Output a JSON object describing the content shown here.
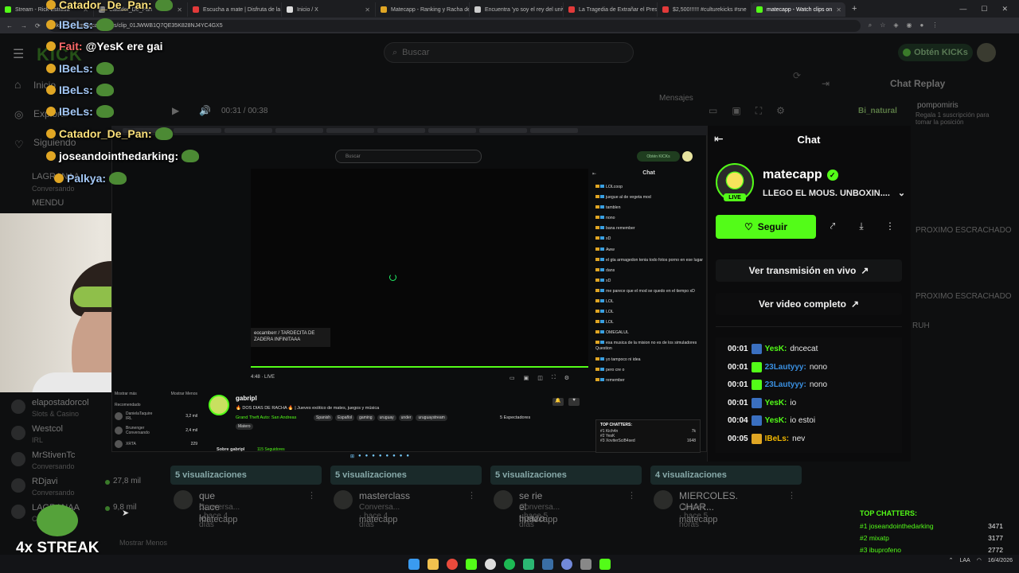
{
  "browser": {
    "tabs": [
      {
        "title": "Stream - Rick Estrada",
        "color": "#53fc18"
      },
      {
        "title": "Catador_De_Pan",
        "color": "#888888"
      },
      {
        "title": "Escucha a mate | Disfruta de la",
        "color": "#e23a3a"
      },
      {
        "title": "Inicio / X",
        "color": "#dddddd"
      },
      {
        "title": "Matecapp - Ranking y Racha de",
        "color": "#e0a624"
      },
      {
        "title": "Encuentra 'yo soy el rey del univ",
        "color": "#cccccc"
      },
      {
        "title": "La Tragedia de Extrañar el Pres",
        "color": "#e23a3a"
      },
      {
        "title": "$2,500!!!!!! #culturekicks #sne",
        "color": "#e23a3a"
      },
      {
        "title": "matecapp - Watch clips on",
        "color": "#53fc18"
      }
    ],
    "url": "kick.com/matecapp/clips/clip_01JWWB1Q7QE35K828NJ4YC4GX5",
    "new_tab": "+",
    "window_controls": [
      "—",
      "☐",
      "✕"
    ]
  },
  "kick_bg": {
    "logo": "KICK",
    "search_placeholder": "Buscar",
    "kicks_button": "Obtén KICKs",
    "sidebar": [
      {
        "label": "Inicio",
        "sub": ""
      },
      {
        "label": "Explorar",
        "sub": ""
      },
      {
        "label": "Siguiendo",
        "sub": ""
      },
      {
        "label": "LAGRANAA",
        "sub": "Conversando"
      },
      {
        "label": "MENDU",
        "sub": ""
      }
    ],
    "sidebar_lower": [
      {
        "name": "elapostadorcol",
        "sub": "Slots & Casino",
        "count": ""
      },
      {
        "name": "Westcol",
        "sub": "IRL",
        "count": ""
      },
      {
        "name": "MrStivenTc",
        "sub": "Conversando",
        "count": ""
      },
      {
        "name": "RDjavi",
        "sub": "Conversando",
        "count": "27,8 mil"
      },
      {
        "name": "LAGRANAA",
        "sub": "Conversando",
        "count": "9,8 mil"
      }
    ],
    "mostrar_menos": "Mostrar Menos",
    "player_time": "00:31 / 00:38",
    "mensajes": "Mensajes",
    "chat_replay_title": "Chat Replay",
    "replay_right": [
      {
        "user": "Bi_natural",
        "text": ""
      },
      {
        "user": "pompomiris",
        "text": "Regala 1 suscripción para tomar la posición"
      },
      {
        "user": "",
        "text": "PROXIMO ESCRACHADO"
      },
      {
        "user": "",
        "text": "PROXIMO ESCRACHADO"
      },
      {
        "user": "",
        "text": "RUH"
      }
    ],
    "videos": [
      {
        "views": "5 visualizaciones",
        "title": "que hace lol",
        "meta": "Conversa... · hace 4 días",
        "channel": "matecapp"
      },
      {
        "views": "5 visualizaciones",
        "title": "masterclass",
        "meta": "Conversa... · hace 4 días",
        "channel": "matecapp"
      },
      {
        "views": "5 visualizaciones",
        "title": "se rie el tipazo",
        "meta": "Conversa... · hace 5 días",
        "channel": "matecapp"
      },
      {
        "views": "4 visualizaciones",
        "title": "MIERCOLES. CHAR...",
        "meta": "Conver... · hace 5 horas",
        "channel": "matecapp"
      }
    ]
  },
  "overlay_chat": [
    {
      "user": "Catador_De_Pan:",
      "text": "",
      "color": "yellow"
    },
    {
      "user": "IBeLs:",
      "text": "",
      "color": "blue"
    },
    {
      "user": "Fait:",
      "text": "@YesK ere gai",
      "color": "red"
    },
    {
      "user": "IBeLs:",
      "text": "",
      "color": "blue"
    },
    {
      "user": "IBeLs:",
      "text": "",
      "color": "blue"
    },
    {
      "user": "IBeLs:",
      "text": "",
      "color": "blue"
    },
    {
      "user": "Catador_De_Pan:",
      "text": "",
      "color": "yellow"
    },
    {
      "user": "joseandointhedarking:",
      "text": "",
      "color": "white"
    },
    {
      "user": "Palkya:",
      "text": "",
      "color": "blue"
    }
  ],
  "inner": {
    "search_placeholder": "Buscar",
    "kicks_button": "Obtén KICKs",
    "chat_title": "Chat",
    "caption": "eocamberr / TARDECITA DE ZADERA INFINITAAA",
    "live": "LIVE",
    "time": "4:48",
    "chat_messages": [
      "LOLcoop",
      "juegue al de vegeta mod",
      "tamblen",
      "nono",
      "bana remember",
      "xD",
      "Aww",
      "el gta armagedon tenia todo fotos porno en ese lugar",
      "dans",
      "xD",
      "me parece que el mod se quedo en el tiempo xD",
      "LOL",
      "LOL",
      "LOL",
      "OMEGALUL",
      "esa musica de la mision no es de los simuladores Question",
      "yo tampoco ni idea",
      "pero cre o",
      "remember"
    ],
    "streamer": {
      "name": "gabripl",
      "title": "🔥 DOS DIAS DE RACHA 🔥 | Jueves exótico de mates, juegos y música",
      "category": "Grand Theft Auto: San Andreas",
      "tags": [
        "Spanish",
        "Español",
        "gaming",
        "uruguay",
        "under",
        "uruguaystream",
        "Matero"
      ],
      "viewers": "5 Espectadores",
      "about": "Sobre gabripl",
      "followers": "115 Seguidores"
    },
    "recommended": {
      "title": "Recomendado",
      "show_more": "Mostrar más",
      "show_less": "Mostrar Menos",
      "items": [
        {
          "name": "DanielaTaquire",
          "sub": "IRL",
          "count": "3,2 mil"
        },
        {
          "name": "Brunenger",
          "sub": "Conversando",
          "count": "2,4 mil"
        },
        {
          "name": "XRTA",
          "sub": "",
          "count": "229"
        }
      ]
    },
    "top_chatters": {
      "title": "TOP CHATTERS:",
      "rows": [
        {
          "rank": "#1 Kich4n",
          "value": "7k"
        },
        {
          "rank": "#2 YesK",
          "value": ""
        },
        {
          "rank": "#3 XoviterSciB4sed",
          "value": "1648"
        }
      ]
    }
  },
  "panel": {
    "title": "Chat",
    "channel_name": "matecapp",
    "live_badge": "LIVE",
    "stream_title": "LLEGO EL MOUS. UNBOXIN....",
    "follow": "Seguir",
    "watch_live": "Ver transmisión en vivo",
    "watch_full": "Ver video completo",
    "replay": [
      {
        "time": "00:01",
        "user": "YesK:",
        "text": "dncecat",
        "color": "green",
        "icon": "#3a6fc0"
      },
      {
        "time": "00:01",
        "user": "23Lautyyy:",
        "text": "nono",
        "color": "blue",
        "icon": "#53fc18"
      },
      {
        "time": "00:01",
        "user": "23Lautyyy:",
        "text": "nono",
        "color": "blue",
        "icon": "#53fc18"
      },
      {
        "time": "00:01",
        "user": "YesK:",
        "text": "io",
        "color": "green",
        "icon": "#3a6fc0"
      },
      {
        "time": "00:04",
        "user": "YesK:",
        "text": "io estoi",
        "color": "green",
        "icon": "#3a6fc0"
      },
      {
        "time": "00:05",
        "user": "IBeLs:",
        "text": "nev",
        "color": "yellow",
        "icon": "#e0a624"
      }
    ]
  },
  "top_chatters": {
    "title": "TOP CHATTERS:",
    "rows": [
      {
        "rank": "#1 joseandointhedarking",
        "value": "3471"
      },
      {
        "rank": "#2 mixatp",
        "value": "3177"
      },
      {
        "rank": "#3 ibuprofeno",
        "value": "2772"
      }
    ]
  },
  "streak": "4x STREAK",
  "taskbar": {
    "tray_lang": "LAA",
    "date": "16/4/2026"
  },
  "colors": {
    "kick_green": "#53fc18",
    "bg": "#0b0c0d"
  }
}
